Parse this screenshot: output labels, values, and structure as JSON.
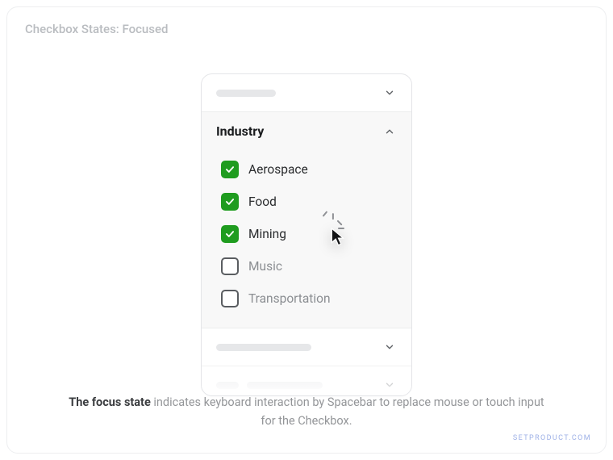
{
  "header": "Checkbox States: Focused",
  "section_title": "Industry",
  "options": [
    {
      "label": "Aerospace",
      "checked": true,
      "focused": false
    },
    {
      "label": "Food",
      "checked": true,
      "focused": false
    },
    {
      "label": "Mining",
      "checked": true,
      "focused": true
    },
    {
      "label": "Music",
      "checked": false,
      "focused": false
    },
    {
      "label": "Transportation",
      "checked": false,
      "focused": false
    }
  ],
  "caption": {
    "bold": "The focus state",
    "rest": " indicates keyboard interaction by Spacebar to replace mouse or touch input for the Checkbox."
  },
  "watermark": "SETPRODUCT.COM",
  "colors": {
    "checkbox_checked": "#1f9c1f",
    "focus_ring": "#bfeabd"
  }
}
